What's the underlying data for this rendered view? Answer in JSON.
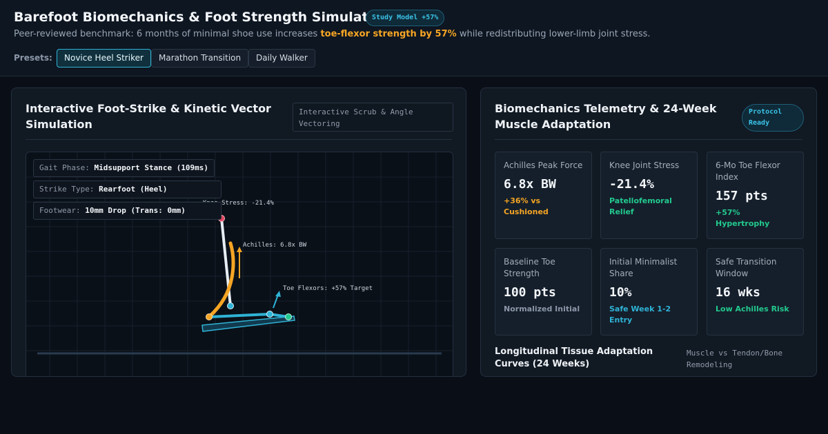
{
  "header": {
    "title": "Barefoot Biomechanics & Foot Strength Simulator",
    "badge": "Study Model +57%",
    "subtitle_pre": "Peer-reviewed benchmark: 6 months of minimal shoe use increases ",
    "subtitle_highlight": "toe-flexor strength by 57%",
    "subtitle_post": " while redistributing lower-limb joint stress.",
    "presets_label": "Presets:",
    "presets": [
      "Novice Heel Striker",
      "Marathon Transition",
      "Daily Walker"
    ],
    "active_preset": "Novice Heel Striker"
  },
  "simulation": {
    "title": "Interactive Foot-Strike & Kinetic Vector Simulation",
    "hint": "Interactive Scrub & Angle Vectoring",
    "gait_phase_label": "Gait Phase:",
    "gait_phase_value": "Midsupport Stance (109ms)",
    "strike_type_label": "Strike Type:",
    "strike_type_value": "Rearfoot (Heel)",
    "footwear_label": "Footwear:",
    "footwear_value": "10mm Drop (Trans: 0mm)",
    "vector_labels": {
      "knee": "Knee Stress: -21.4%",
      "achilles": "Achilles: 6.8x BW",
      "toe": "Toe Flexors: +57% Target"
    }
  },
  "telemetry": {
    "title": "Biomechanics Telemetry & 24-Week Muscle Adaptation",
    "status": "Protocol Ready",
    "cards": [
      {
        "label": "Achilles Peak Force",
        "value": "6.8x BW",
        "sub": "+36% vs Cushioned",
        "tone": "orange"
      },
      {
        "label": "Knee Joint Stress",
        "value": "-21.4%",
        "sub": "Patellofemoral Relief",
        "tone": "green"
      },
      {
        "label": "6-Mo Toe Flexor Index",
        "value": "157 pts",
        "sub": "+57% Hypertrophy",
        "tone": "green"
      },
      {
        "label": "Baseline Toe Strength",
        "value": "100 pts",
        "sub": "Normalized Initial",
        "tone": "grey"
      },
      {
        "label": "Initial Minimalist Share",
        "value": "10%",
        "sub": "Safe Week 1-2 Entry",
        "tone": "cyan"
      },
      {
        "label": "Safe Transition Window",
        "value": "16 wks",
        "sub": "Low Achilles Risk",
        "tone": "green"
      }
    ],
    "curves_title": "Longitudinal Tissue Adaptation Curves (24 Weeks)",
    "curves_legend": "Muscle vs Tendon/Bone Remodeling"
  },
  "colors": {
    "accent": "#2fb3d6",
    "orange": "#f5a524",
    "green": "#22c98e",
    "knee": "#e0455e"
  }
}
